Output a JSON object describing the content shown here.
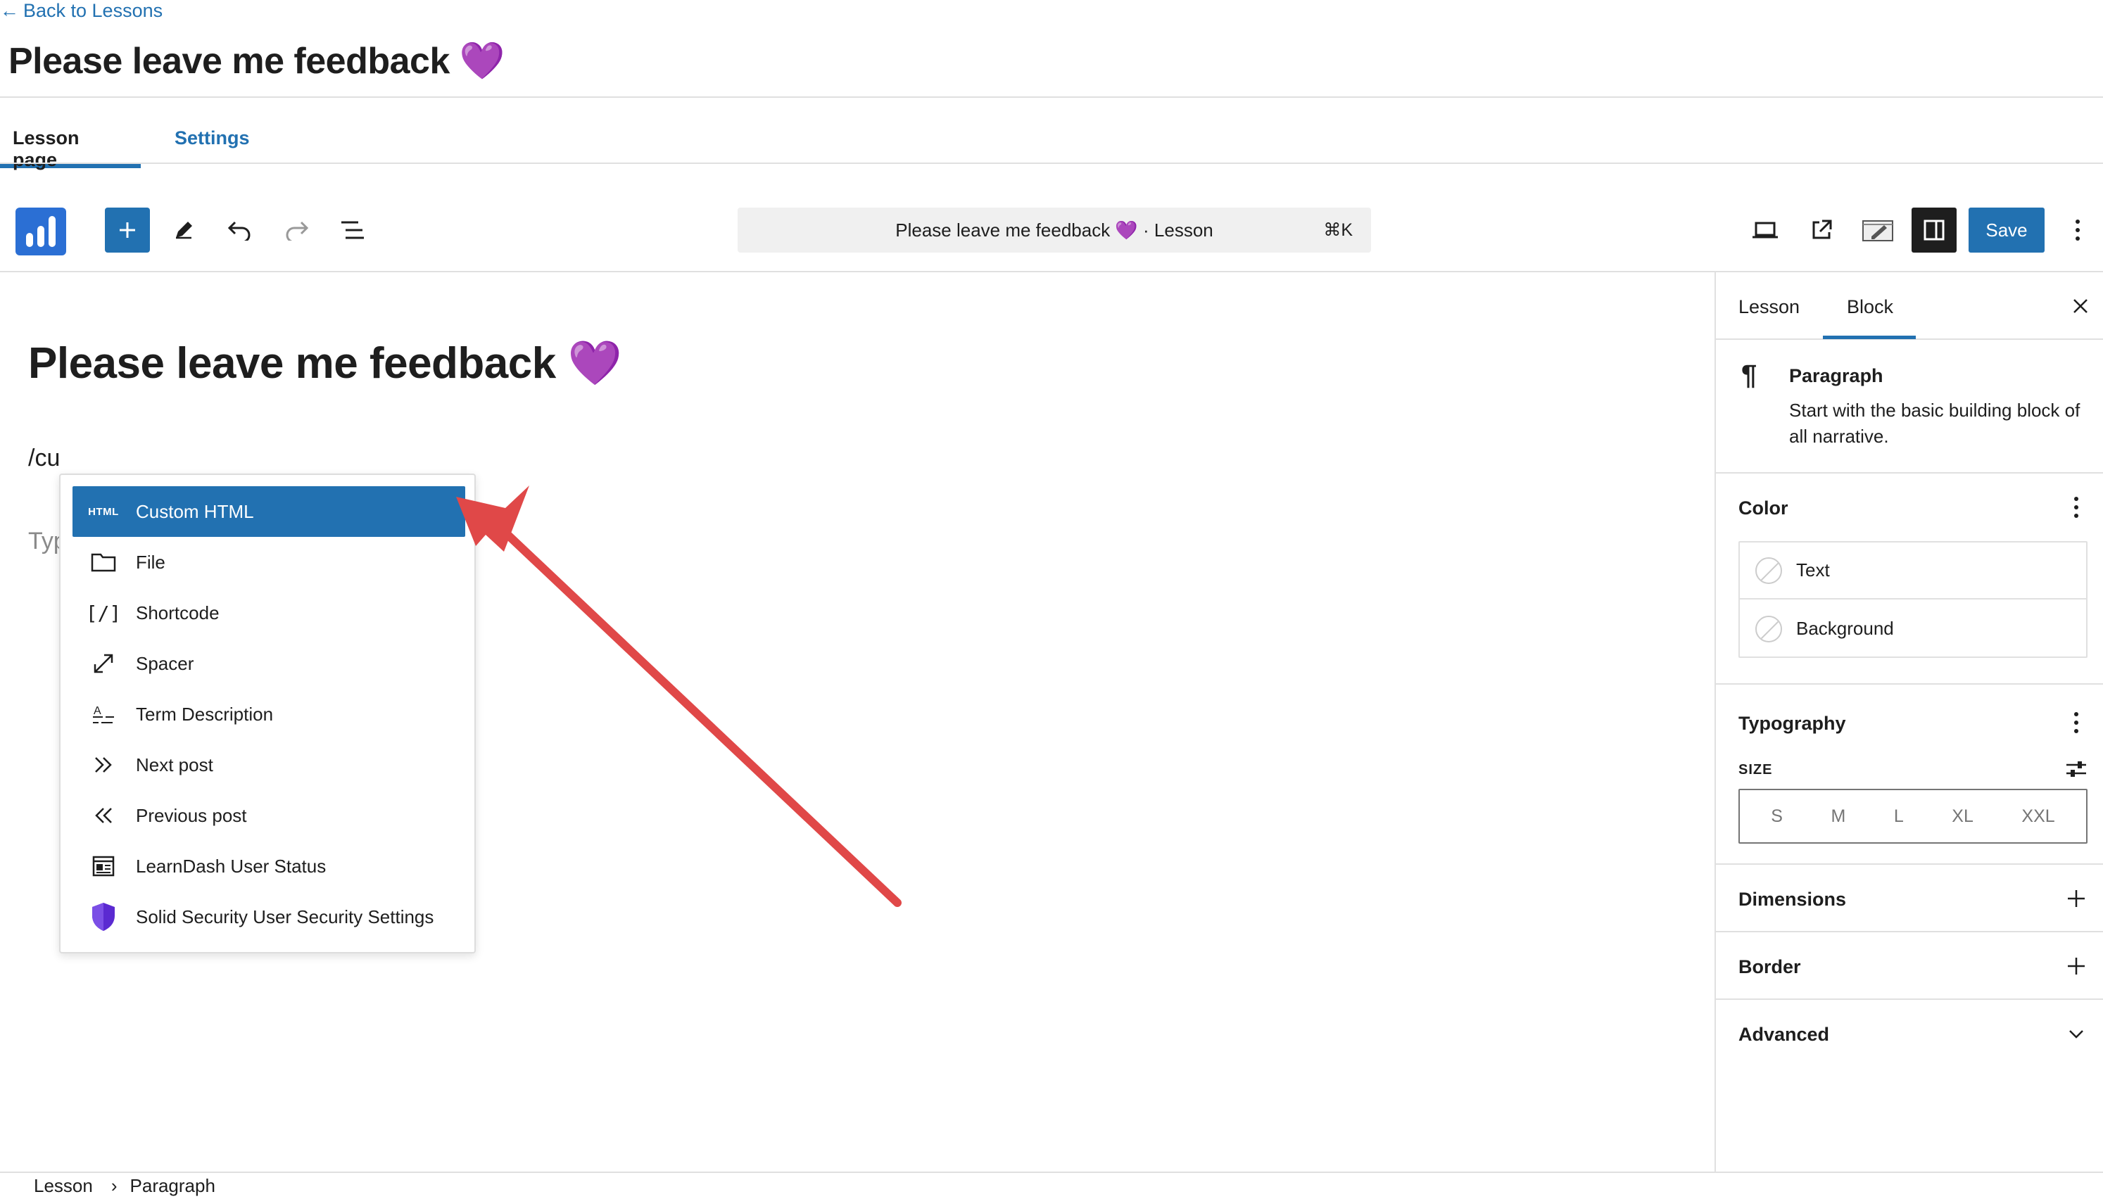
{
  "header": {
    "back_link": "Back to Lessons",
    "title": "Please leave me feedback 💜"
  },
  "tabs": [
    {
      "label": "Lesson page",
      "active": true
    },
    {
      "label": "Settings",
      "active": false
    }
  ],
  "toolbar": {
    "command_title": "Please leave me feedback 💜 · Lesson",
    "command_shortcut": "⌘K",
    "save_label": "Save",
    "icons": [
      "logo-icon",
      "add-block-icon",
      "pencil-icon",
      "undo-icon",
      "redo-icon",
      "document-overview-icon",
      "laptop-icon",
      "external-link-icon",
      "preview-icon",
      "sidebar-icon",
      "more-vertical-icon"
    ],
    "accent_color": "#2271b1"
  },
  "canvas": {
    "title": "Please leave me feedback 💜",
    "slash_text": "/cu",
    "placeholder": "Typ"
  },
  "inserter": {
    "items": [
      {
        "label": "Custom HTML",
        "icon": "html-icon",
        "icon_text": "HTML",
        "selected": true
      },
      {
        "label": "File",
        "icon": "folder-icon",
        "selected": false
      },
      {
        "label": "Shortcode",
        "icon": "shortcode-icon",
        "icon_text": "[/]",
        "selected": false
      },
      {
        "label": "Spacer",
        "icon": "resize-icon",
        "selected": false
      },
      {
        "label": "Term Description",
        "icon": "term-description-icon",
        "selected": false
      },
      {
        "label": "Next post",
        "icon": "chevrons-right-icon",
        "selected": false
      },
      {
        "label": "Previous post",
        "icon": "chevrons-left-icon",
        "selected": false
      },
      {
        "label": "LearnDash User Status",
        "icon": "user-status-icon",
        "selected": false
      },
      {
        "label": "Solid Security User Security Settings",
        "icon": "shield-icon",
        "selected": false
      }
    ]
  },
  "sidebar": {
    "tabs": [
      {
        "label": "Lesson",
        "active": false
      },
      {
        "label": "Block",
        "active": true
      }
    ],
    "block": {
      "name": "Paragraph",
      "description": "Start with the basic building block of all narrative."
    },
    "color": {
      "title": "Color",
      "items": [
        "Text",
        "Background"
      ]
    },
    "typography": {
      "title": "Typography",
      "size_label": "SIZE",
      "sizes": [
        "S",
        "M",
        "L",
        "XL",
        "XXL"
      ]
    },
    "dimensions": "Dimensions",
    "border": "Border",
    "advanced": "Advanced"
  },
  "footer": {
    "breadcrumb": [
      "Lesson",
      "Paragraph"
    ]
  }
}
